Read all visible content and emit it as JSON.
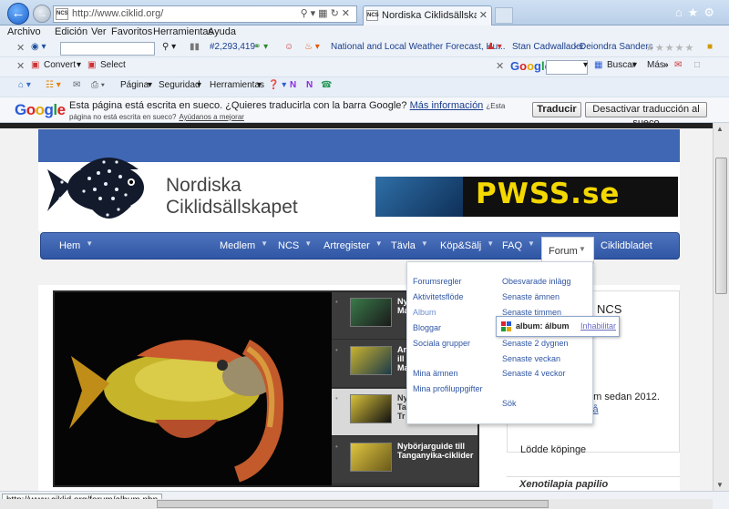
{
  "browser": {
    "address_url": "http://www.ciklid.org/",
    "tab_title": "Nordiska Ciklidsällskapet - ...",
    "site_icon_text": "NCS",
    "status_url": "http://www.ciklid.org/forum/album.php"
  },
  "menubar": [
    "Archivo",
    "Edición",
    "Ver",
    "Favoritos",
    "Herramientas",
    "Ayuda"
  ],
  "toolbar1": {
    "count": "#2,293,419",
    "weather_link": "National and Local Weather Forecast, Hu...",
    "people_links": [
      "Stan Cadwallader",
      "Deiondra Sanders"
    ]
  },
  "toolbar2": {
    "convert_label": "Convert",
    "select_label": "Select",
    "search_engine": "Google",
    "search_btn": "Buscar",
    "more_label": "Más"
  },
  "toolbar3": {
    "page_label": "Página",
    "security_label": "Seguridad",
    "tools_label": "Herramientas"
  },
  "translate_bar": {
    "logo": "Google",
    "message": "Esta página está escrita en sueco. ¿Quieres traducirla con la barra Google?",
    "more_info": "Más información",
    "small_text": "¿Esta página no está escrita en sueco?",
    "help_link": "Ayúdanos a mejorar",
    "translate_btn": "Traducir",
    "disable_btn": "Desactivar traducción al sueco"
  },
  "site": {
    "title_line1": "Nordiska",
    "title_line2": "Ciklidsällskapet",
    "banner_text": "PWSS.se",
    "nav": [
      "Hem",
      "Medlem",
      "NCS",
      "Artregister",
      "Tävla",
      "Köp&Sälj",
      "FAQ",
      "Forum",
      "Ciklidbladet"
    ],
    "slides": [
      {
        "title": "Ny\nMa"
      },
      {
        "title": "Ar\nill\nMa"
      },
      {
        "title": "Ny\nTa\nTr"
      },
      {
        "title": "Nybörjarguide till Tanganyika-ciklider"
      }
    ],
    "sidebar_title": "NCS",
    "sidebar_text": "em sedan 2012.",
    "sidebar_link": "så",
    "sidebar_location": "Lödde köpinge",
    "xeno_title": "Xenotilapia papilio"
  },
  "forum_dropdown": {
    "left": [
      "Forumsregler",
      "Aktivitetsflöde",
      "Album",
      "Bloggar",
      "Sociala grupper",
      "Mina ämnen",
      "Mina profiluppgifter"
    ],
    "right": [
      "Obesvarade inlägg",
      "Senaste ämnen",
      "Senaste timmen",
      "Senaste 2 dygnen",
      "Senaste veckan",
      "Senaste 4 veckor",
      "Sök"
    ],
    "tooltip_text": "album: álbum",
    "tooltip_link": "Inhabilitar"
  }
}
